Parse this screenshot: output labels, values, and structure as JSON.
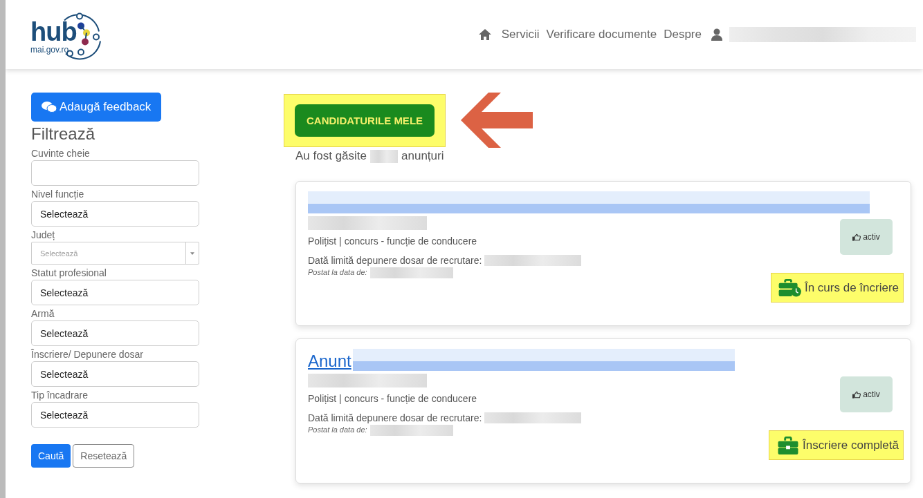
{
  "header": {
    "logo": {
      "word": "hub",
      "domain": "mai.gov.ro"
    },
    "nav": [
      "Servicii",
      "Verificare documente",
      "Despre"
    ]
  },
  "sidebar": {
    "feedback_button": "Adaugă feedback",
    "title": "Filtrează",
    "filters": [
      {
        "label": "Cuvinte cheie",
        "kind": "text"
      },
      {
        "label": "Nivel funcție",
        "kind": "select",
        "value": "Selectează"
      },
      {
        "label": "Județ",
        "kind": "combo",
        "placeholder": "Selectează"
      },
      {
        "label": "Statut profesional",
        "kind": "select",
        "value": "Selectează"
      },
      {
        "label": "Armă",
        "kind": "select",
        "value": "Selectează"
      },
      {
        "label": "Înscriere/ Depunere dosar",
        "kind": "select",
        "value": "Selectează"
      },
      {
        "label": "Tip încadrare",
        "kind": "select",
        "value": "Selectează"
      }
    ],
    "search_button": "Caută",
    "reset_button": "Resetează"
  },
  "main": {
    "my_applications_button": {
      "label": "CANDIDATURILE MELE",
      "highlighted": true
    },
    "results": {
      "before": "Au fost găsite",
      "after": "anunțuri"
    },
    "cards": [
      {
        "category": "Polițist | concurs - funcție de conducere",
        "deadline_label": "Dată limită depunere dosar de recrutare:",
        "posted_label": "Postat la data de:",
        "badge": "activ",
        "status": {
          "kind": "in_progress",
          "label": "În curs de încriere",
          "highlighted": true
        }
      },
      {
        "title": "Anunt",
        "category": "Polițist | concurs - funcție de conducere",
        "deadline_label": "Dată limită depunere dosar de recrutare:",
        "posted_label": "Postat la data de:",
        "badge": "activ",
        "status": {
          "kind": "complete",
          "label": "Înscriere completă",
          "highlighted": true
        }
      }
    ]
  }
}
